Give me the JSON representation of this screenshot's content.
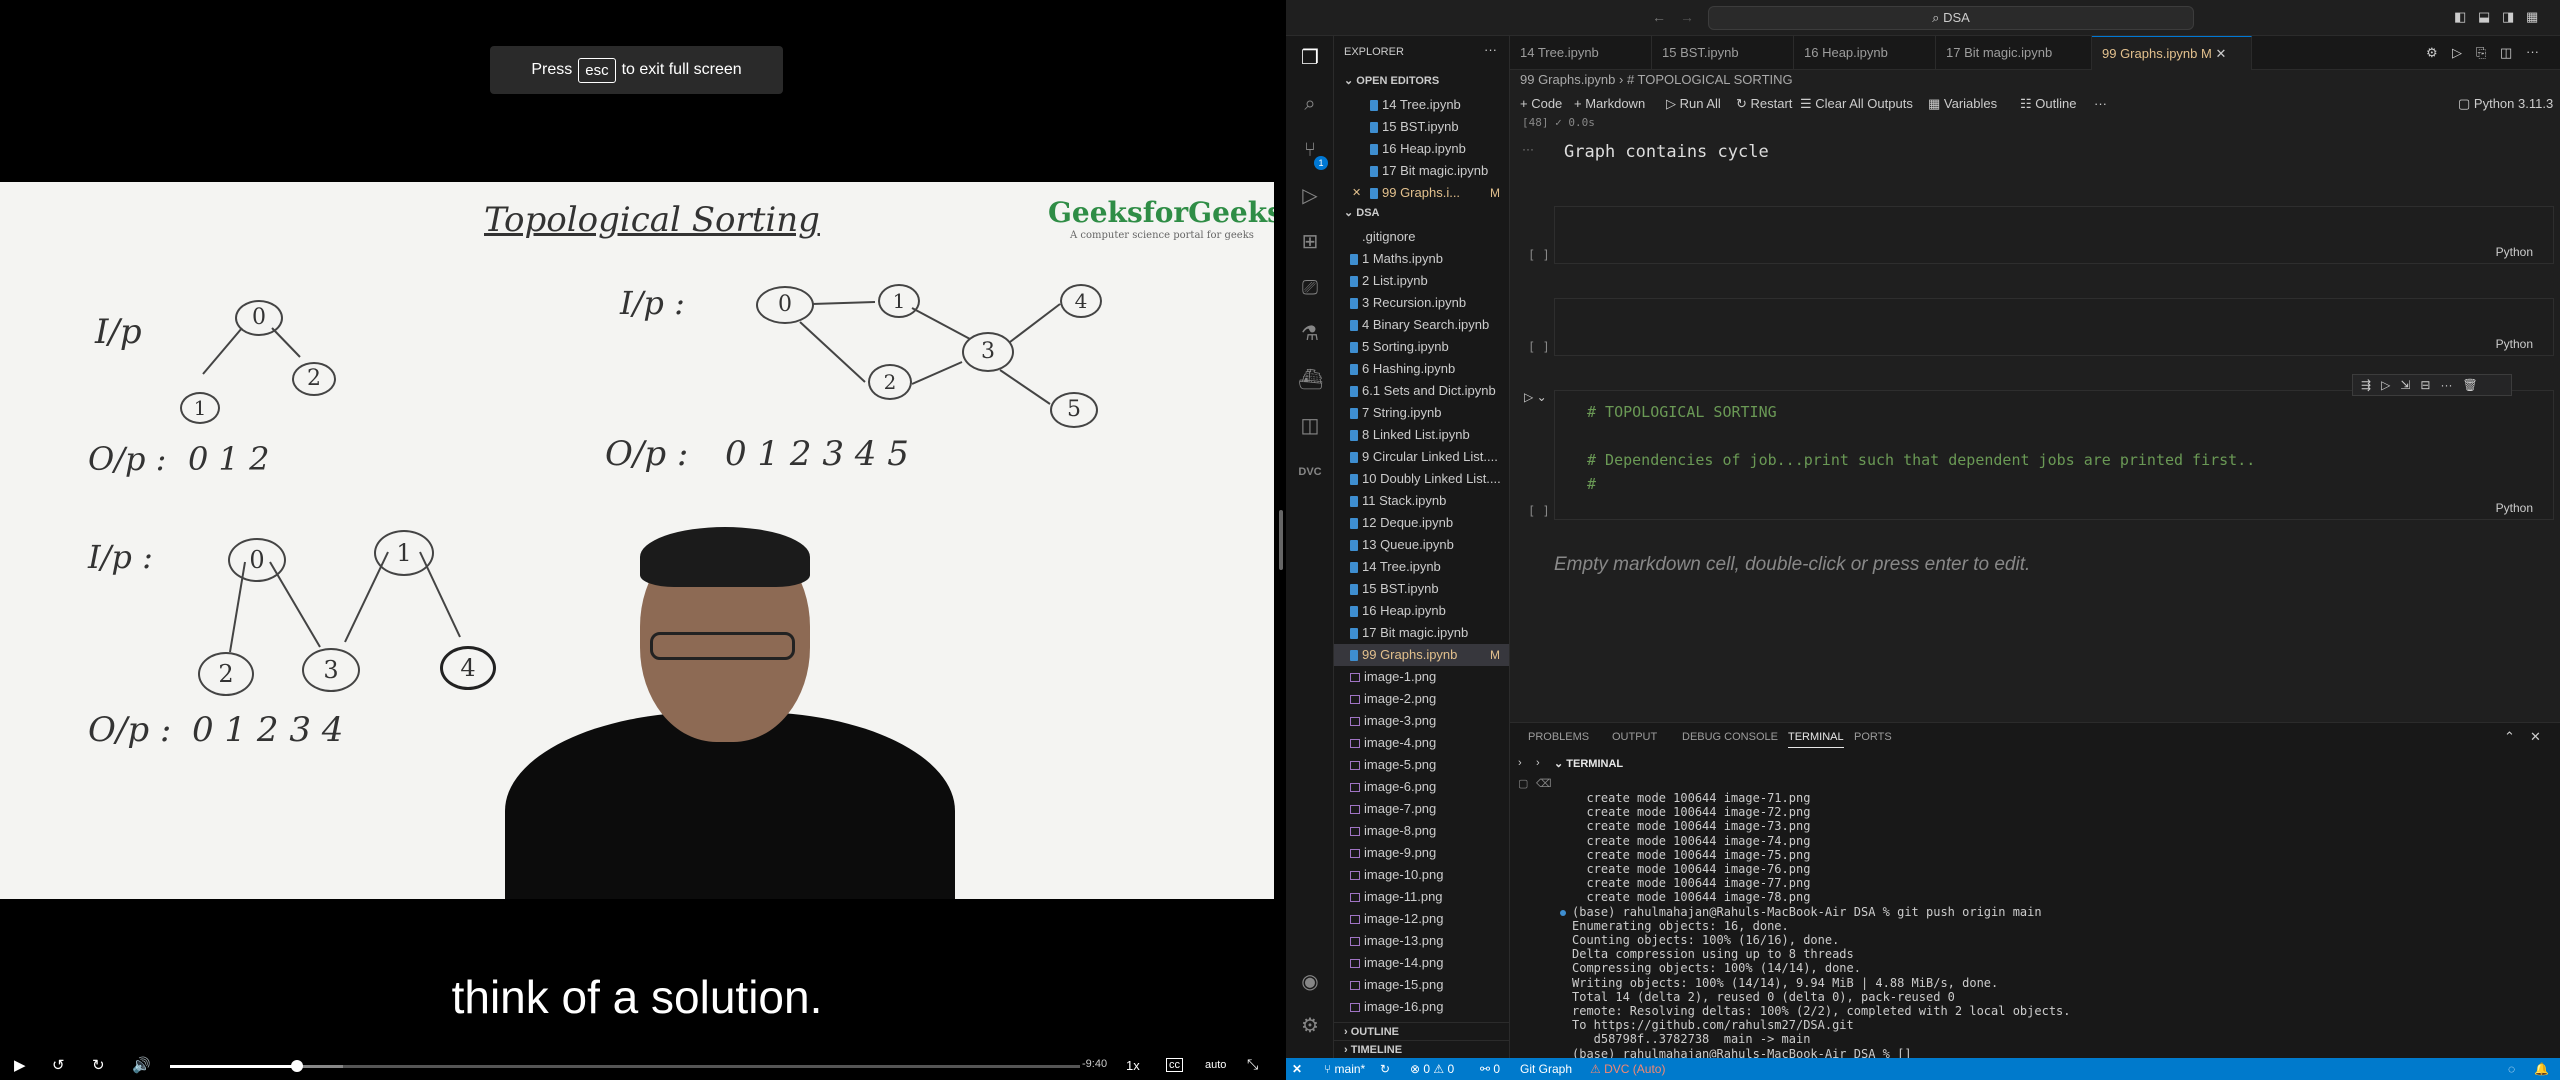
{
  "video": {
    "esc_prefix": "Press",
    "esc_key": "esc",
    "esc_suffix": "to exit full screen",
    "logo": "GeeksforGeeks",
    "logo_tagline": "A computer science portal for geeks",
    "board_title": "Topological Sorting",
    "board": {
      "ip1": "I/p",
      "op1": "O/p :",
      "op1_values": "0   1   2",
      "ip2": "I/p :",
      "op2": "O/p :",
      "op2_values": "0   1   2   3   4  5",
      "ip3": "I/p :",
      "op3": "O/p :",
      "op3_values": "0   1   2   3   4",
      "g1_nodes": [
        "0",
        "1",
        "2"
      ],
      "g2_nodes": [
        "0",
        "1",
        "2",
        "3",
        "4",
        "5"
      ],
      "g3_nodes": [
        "0",
        "1",
        "2",
        "3",
        "4"
      ]
    },
    "subtitle": "think of a solution.",
    "time_remaining": "-9:40",
    "speed": "1x",
    "quality": "auto",
    "progress_fraction": 0.14,
    "buffered_fraction": 0.19
  },
  "vscode": {
    "search_text": "DSA",
    "explorer_title": "EXPLORER",
    "open_editors_title": "OPEN EDITORS",
    "open_editors": [
      "14 Tree.ipynb",
      "15 BST.ipynb",
      "16 Heap.ipynb",
      "17 Bit magic.ipynb",
      "99 Graphs.i..."
    ],
    "open_editor_active_mod": "M",
    "folder_title": "DSA",
    "files": [
      ".gitignore",
      "1 Maths.ipynb",
      "2 List.ipynb",
      "3 Recursion.ipynb",
      "4 Binary Search.ipynb",
      "5 Sorting.ipynb",
      "6 Hashing.ipynb",
      "6.1 Sets and Dict.ipynb",
      "7 String.ipynb",
      "8 Linked List.ipynb",
      "9 Circular Linked List....",
      "10 Doubly Linked List....",
      "11 Stack.ipynb",
      "12 Deque.ipynb",
      "13 Queue.ipynb",
      "14 Tree.ipynb",
      "15 BST.ipynb",
      "16 Heap.ipynb",
      "17 Bit magic.ipynb",
      "99 Graphs.ipynb",
      "image-1.png",
      "image-2.png",
      "image-3.png",
      "image-4.png",
      "image-5.png",
      "image-6.png",
      "image-7.png",
      "image-8.png",
      "image-9.png",
      "image-10.png",
      "image-11.png",
      "image-12.png",
      "image-13.png",
      "image-14.png",
      "image-15.png",
      "image-16.png"
    ],
    "file_mod": "M",
    "outline_title": "OUTLINE",
    "timeline_title": "TIMELINE",
    "tabs": [
      "14 Tree.ipynb",
      "15 BST.ipynb",
      "16 Heap.ipynb",
      "17 Bit magic.ipynb",
      "99 Graphs.ipynb"
    ],
    "active_tab_mod": "M",
    "breadcrumb": "99 Graphs.ipynb  ›  # TOPOLOGICAL SORTING",
    "toolbar": {
      "code": "+ Code",
      "markdown": "+ Markdown",
      "run_all": "▷ Run All",
      "restart": "↻ Restart",
      "clear": "Clear All Outputs",
      "variables": "Variables",
      "outline": "Outline",
      "kernel": "Python 3.11.3"
    },
    "cells": {
      "prev_exec": "[48]   ✓  0.0s",
      "output": "Graph contains cycle",
      "empty_bracket": "[ ]",
      "lang": "Python",
      "code_line1": "# TOPOLOGICAL SORTING",
      "code_line2": "# Dependencies of job...print such that dependent jobs are printed first..",
      "code_line3": "#",
      "markdown_placeholder": "Empty markdown cell, double-click or press enter to edit."
    },
    "panel_tabs": [
      "PROBLEMS",
      "OUTPUT",
      "DEBUG CONSOLE",
      "TERMINAL",
      "PORTS"
    ],
    "terminal_title": "TERMINAL",
    "terminal_lines": [
      "  create mode 100644 image-71.png",
      "  create mode 100644 image-72.png",
      "  create mode 100644 image-73.png",
      "  create mode 100644 image-74.png",
      "  create mode 100644 image-75.png",
      "  create mode 100644 image-76.png",
      "  create mode 100644 image-77.png",
      "  create mode 100644 image-78.png",
      "(base) rahulmahajan@Rahuls-MacBook-Air DSA % git push origin main",
      "Enumerating objects: 16, done.",
      "Counting objects: 100% (16/16), done.",
      "Delta compression using up to 8 threads",
      "Compressing objects: 100% (14/14), done.",
      "Writing objects: 100% (14/14), 9.94 MiB | 4.88 MiB/s, done.",
      "Total 14 (delta 2), reused 0 (delta 0), pack-reused 0",
      "remote: Resolving deltas: 100% (2/2), completed with 2 local objects.",
      "To https://github.com/rahulsm27/DSA.git",
      "   d58798f..3782738  main -> main",
      "(base) rahulmahajan@Rahuls-MacBook-Air DSA % []"
    ],
    "status": {
      "branch": "main*",
      "errors": "⊗ 0 ⚠ 0",
      "ports": "⚯ 0",
      "git_graph": "Git Graph",
      "dvc": "DVC (Auto)"
    },
    "badge_count": "1"
  },
  "colors": {
    "accent": "#007acc",
    "modified": "#e2c08d",
    "comment": "#6a9955",
    "brand_green": "#2f8d46"
  }
}
